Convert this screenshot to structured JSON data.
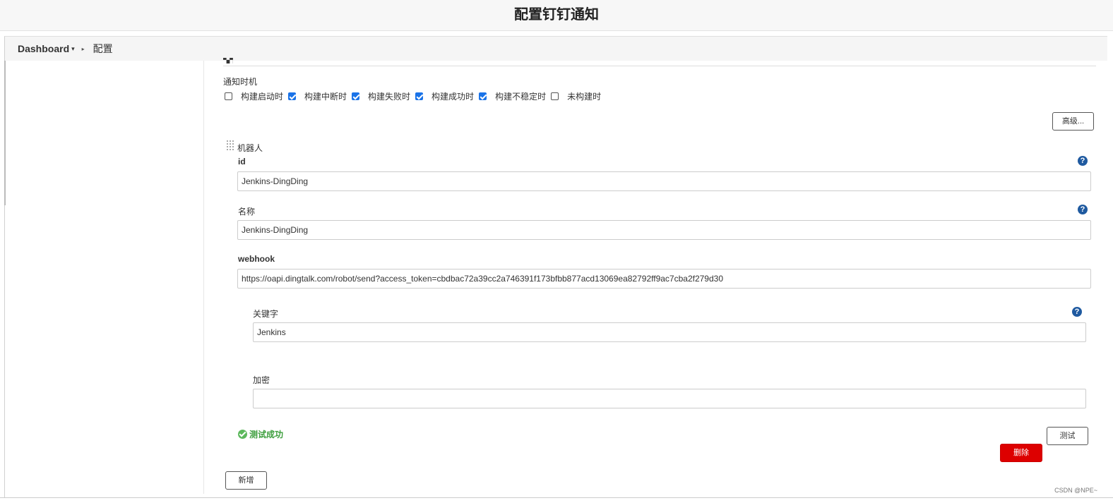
{
  "header": {
    "title": "配置钉钉通知"
  },
  "breadcrumb": {
    "dashboard": "Dashboard",
    "caret": "▾",
    "separator": "▸",
    "current": "配置"
  },
  "notify": {
    "label": "通知时机",
    "options": [
      {
        "label": "构建启动时",
        "checked": false
      },
      {
        "label": "构建中断时",
        "checked": true
      },
      {
        "label": "构建失败时",
        "checked": true
      },
      {
        "label": "构建成功时",
        "checked": true
      },
      {
        "label": "构建不稳定时",
        "checked": true
      },
      {
        "label": "未构建时",
        "checked": false
      }
    ]
  },
  "advanced_button": "高级...",
  "robot": {
    "label": "机器人",
    "id_label": "id",
    "id_value": "Jenkins-DingDing",
    "name_label": "名称",
    "name_value": "Jenkins-DingDing",
    "webhook_label": "webhook",
    "webhook_value": "https://oapi.dingtalk.com/robot/send?access_token=cbdbac72a39cc2a746391f173bfbb877acd13069ea82792ff9ac7cba2f279d30",
    "keyword_label": "关键字",
    "keyword_value": "Jenkins",
    "secret_label": "加密",
    "secret_value": "",
    "test_status": "测试成功",
    "test_button": "测试",
    "delete_button": "删除"
  },
  "add_button": "新增",
  "help_icon": "?",
  "watermark": "CSDN @NPE~",
  "colors": {
    "accent": "#1f5aa0",
    "danger": "#dd0000",
    "success": "#3c9e3c",
    "checkbox": "#1a73e8"
  }
}
